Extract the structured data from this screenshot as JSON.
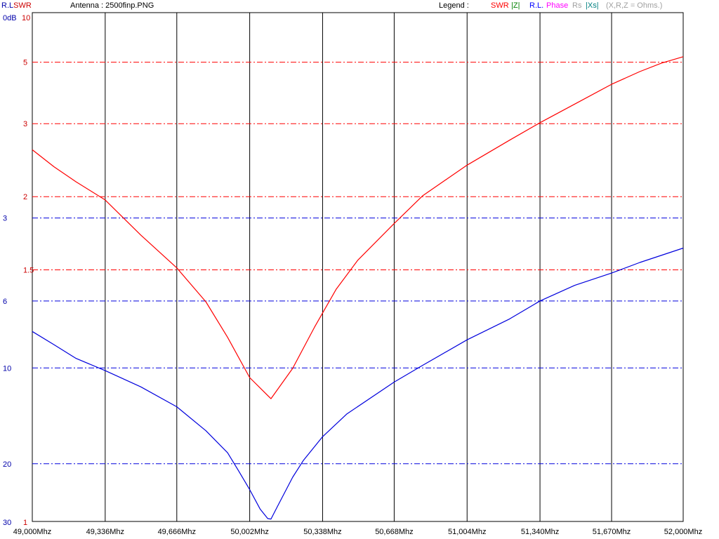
{
  "header": {
    "rl_label": "R.L",
    "swr_label": "SWR",
    "antenna_text": "Antenna : 2500finp.PNG",
    "legend_label": "Legend :"
  },
  "legend_items": [
    {
      "text": "SWR",
      "color": "#ff0000"
    },
    {
      "text": "|Z|",
      "color": "#008000"
    },
    {
      "text": "R.L.",
      "color": "#0000ff"
    },
    {
      "text": "Phase",
      "color": "#ff00ff"
    },
    {
      "text": "Rs",
      "color": "#a0a0a0"
    },
    {
      "text": "|Xs|",
      "color": "#008080"
    },
    {
      "text": "(X,R,Z = Ohms.)",
      "color": "#a0a0a0"
    }
  ],
  "colors": {
    "swr": "#ff0000",
    "rl": "#0000dd",
    "grid": "#000000",
    "label_rl": "#0000aa",
    "label_swr": "#cc0000"
  },
  "chart_data": {
    "type": "line",
    "x_unit": "Mhz",
    "xlim": [
      49.0,
      52.0
    ],
    "x_ticks": [
      {
        "value": 49.0,
        "label": "49,000Mhz"
      },
      {
        "value": 49.336,
        "label": "49,336Mhz"
      },
      {
        "value": 49.666,
        "label": "49,666Mhz"
      },
      {
        "value": 50.002,
        "label": "50,002Mhz"
      },
      {
        "value": 50.338,
        "label": "50,338Mhz"
      },
      {
        "value": 50.668,
        "label": "50,668Mhz"
      },
      {
        "value": 51.004,
        "label": "51,004Mhz"
      },
      {
        "value": 51.34,
        "label": "51,340Mhz"
      },
      {
        "value": 51.67,
        "label": "51,670Mhz"
      },
      {
        "value": 52.0,
        "label": "52,000Mhz"
      }
    ],
    "rl_axis": {
      "unit": "dB",
      "range": [
        0,
        30
      ],
      "ticks": [
        {
          "value": 0,
          "label": "0dB"
        },
        {
          "value": 3,
          "label": "3"
        },
        {
          "value": 6,
          "label": "6"
        },
        {
          "value": 10,
          "label": "10"
        },
        {
          "value": 20,
          "label": "20"
        },
        {
          "value": 30,
          "label": "30"
        }
      ]
    },
    "swr_axis": {
      "range": [
        1,
        10
      ],
      "ticks": [
        {
          "value": 10,
          "label": "10"
        },
        {
          "value": 5,
          "label": "5"
        },
        {
          "value": 3,
          "label": "3"
        },
        {
          "value": 2,
          "label": "2"
        },
        {
          "value": 1.5,
          "label": "1.5"
        },
        {
          "value": 1,
          "label": "1"
        }
      ]
    },
    "series": [
      {
        "name": "SWR",
        "color": "#ff0000",
        "x": [
          49.0,
          49.1,
          49.2,
          49.336,
          49.5,
          49.666,
          49.8,
          49.9,
          50.002,
          50.1,
          50.2,
          50.3,
          50.4,
          50.5,
          50.668,
          50.8,
          51.004,
          51.2,
          51.34,
          51.5,
          51.67,
          51.8,
          51.9,
          52.0
        ],
        "values": [
          2.55,
          2.32,
          2.15,
          1.97,
          1.7,
          1.51,
          1.36,
          1.24,
          1.14,
          1.1,
          1.16,
          1.27,
          1.41,
          1.55,
          1.78,
          2.01,
          2.34,
          2.7,
          3.02,
          3.45,
          4.05,
          4.55,
          4.95,
          5.3
        ]
      },
      {
        "name": "R.L.",
        "color": "#0000dd",
        "x": [
          49.0,
          49.1,
          49.2,
          49.336,
          49.5,
          49.666,
          49.8,
          49.9,
          49.95,
          50.002,
          50.05,
          50.085,
          50.1,
          50.13,
          50.2,
          50.25,
          50.338,
          50.45,
          50.668,
          50.8,
          51.004,
          51.2,
          51.34,
          51.5,
          51.67,
          51.8,
          52.0
        ],
        "values": [
          7.6,
          8.4,
          9.3,
          10.2,
          11.5,
          13.3,
          15.8,
          18.5,
          21.0,
          24.0,
          27.5,
          29.4,
          29.5,
          27.0,
          22.0,
          19.5,
          16.5,
          14.0,
          11.1,
          9.8,
          8.1,
          6.9,
          6.0,
          5.3,
          4.8,
          4.4,
          3.9
        ]
      }
    ],
    "grid": {
      "vertical": true,
      "rl_horizontal": true,
      "swr_horizontal": true
    }
  }
}
